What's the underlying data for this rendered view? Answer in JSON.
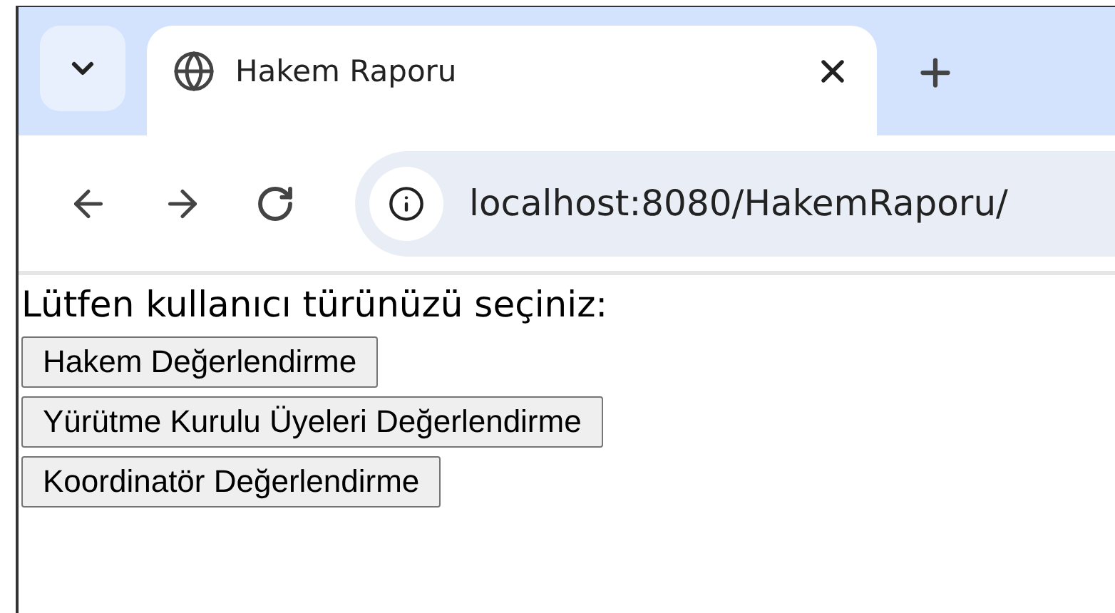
{
  "browser": {
    "tab": {
      "title": "Hakem Raporu",
      "selected": true
    },
    "address": "localhost:8080/HakemRaporu/"
  },
  "page": {
    "prompt": "Lütfen kullanıcı türünüzü seçiniz:",
    "buttons": [
      "Hakem Değerlendirme",
      "Yürütme Kurulu Üyeleri Değerlendirme",
      "Koordinatör Değerlendirme"
    ]
  }
}
